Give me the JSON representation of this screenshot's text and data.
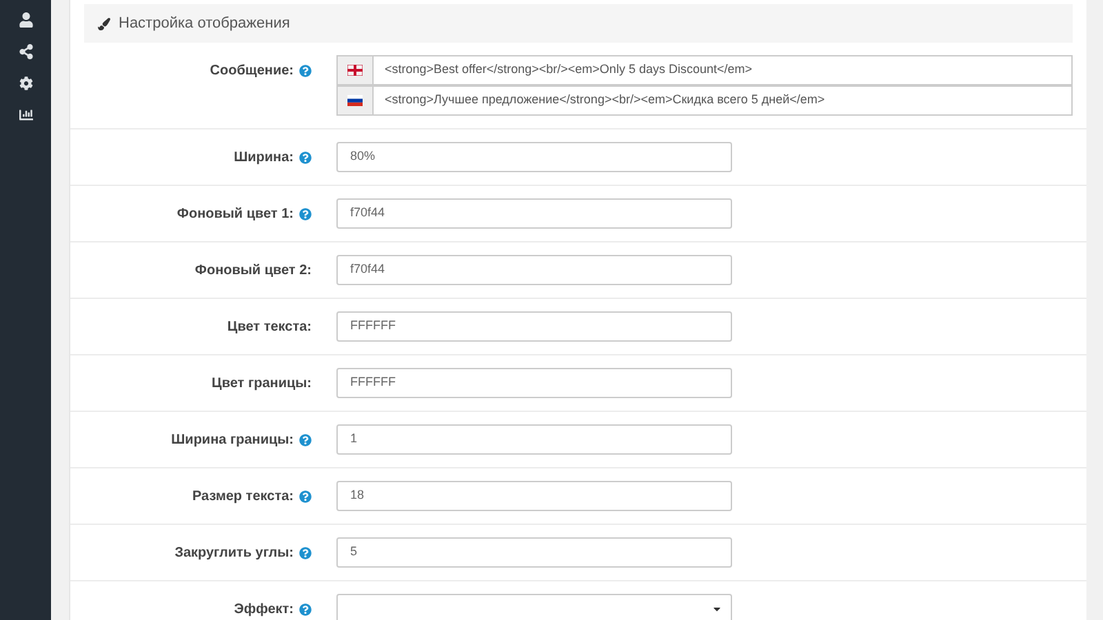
{
  "panel": {
    "title": "Настройка отображения"
  },
  "message": {
    "label": "Сообщение:",
    "help": true,
    "translations": [
      {
        "kind": "en",
        "value": "<strong>Best offer</strong><br/><em>Only 5 days Discount</em>"
      },
      {
        "kind": "ru",
        "value": "<strong>Лучшее предложение</strong><br/><em>Скидка всего 5 дней</em>"
      }
    ]
  },
  "fields": [
    {
      "kind": "text",
      "label": "Ширина:",
      "help": true,
      "value": "80%"
    },
    {
      "kind": "text",
      "label": "Фоновый цвет 1:",
      "help": true,
      "value": "f70f44"
    },
    {
      "kind": "text",
      "label": "Фоновый цвет 2:",
      "help": false,
      "value": "f70f44"
    },
    {
      "kind": "text",
      "label": "Цвет текста:",
      "help": false,
      "value": "FFFFFF"
    },
    {
      "kind": "text",
      "label": "Цвет границы:",
      "help": false,
      "value": "FFFFFF"
    },
    {
      "kind": "text",
      "label": "Ширина границы:",
      "help": true,
      "value": "1"
    },
    {
      "kind": "text",
      "label": "Размер текста:",
      "help": true,
      "value": "18"
    },
    {
      "kind": "text",
      "label": "Закруглить углы:",
      "help": true,
      "value": "5"
    },
    {
      "kind": "select",
      "label": "Эффект:",
      "help": true
    }
  ]
}
